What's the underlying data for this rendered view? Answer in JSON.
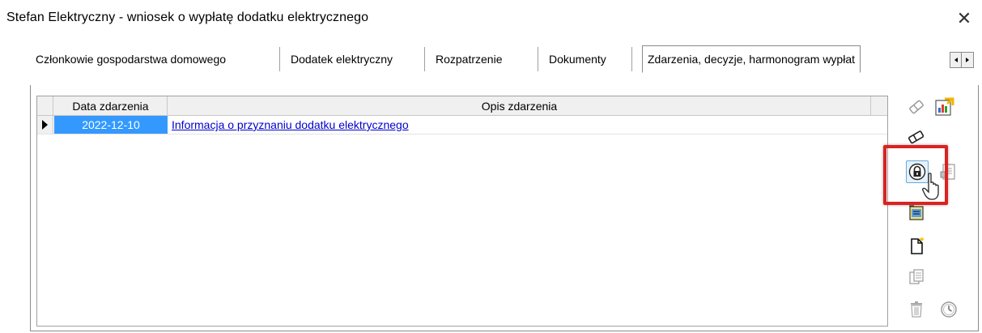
{
  "window": {
    "title": "Stefan Elektryczny - wniosek o wypłatę dodatku elektrycznego",
    "close_icon": "close-icon"
  },
  "tabs": [
    {
      "label": "Członkowie gospodarstwa domowego",
      "active": false
    },
    {
      "label": "Dodatek elektryczny",
      "active": false
    },
    {
      "label": "Rozpatrzenie",
      "active": false
    },
    {
      "label": "Dokumenty",
      "active": false
    },
    {
      "label": "Zdarzenia, decyzje, harmonogram wypłat",
      "active": true
    }
  ],
  "tab_scroll": {
    "left_icon": "scroll-left-icon",
    "right_icon": "scroll-right-icon"
  },
  "grid": {
    "columns": [
      "Data zdarzenia",
      "Opis zdarzenia"
    ],
    "rows": [
      {
        "date": "2022-12-10",
        "description": "Informacja o przyznaniu dodatku elektrycznego",
        "selected": true
      }
    ]
  },
  "toolbar": {
    "buttons": [
      {
        "name": "eraser-icon",
        "enabled": false
      },
      {
        "name": "export-chart-icon",
        "enabled": true
      },
      {
        "name": "eraser-alt-icon",
        "enabled": true
      },
      {
        "name": "lock-icon",
        "enabled": true,
        "highlighted": true
      },
      {
        "name": "document-lock-icon",
        "enabled": false
      },
      {
        "name": "document-edit-icon",
        "enabled": true
      },
      {
        "name": "new-document-icon",
        "enabled": true
      },
      {
        "name": "copy-document-icon",
        "enabled": false
      },
      {
        "name": "trash-icon",
        "enabled": false
      },
      {
        "name": "clock-icon",
        "enabled": false
      }
    ]
  },
  "colors": {
    "selection": "#3399ff",
    "link": "#0000cc",
    "highlight_frame": "#d92323"
  }
}
